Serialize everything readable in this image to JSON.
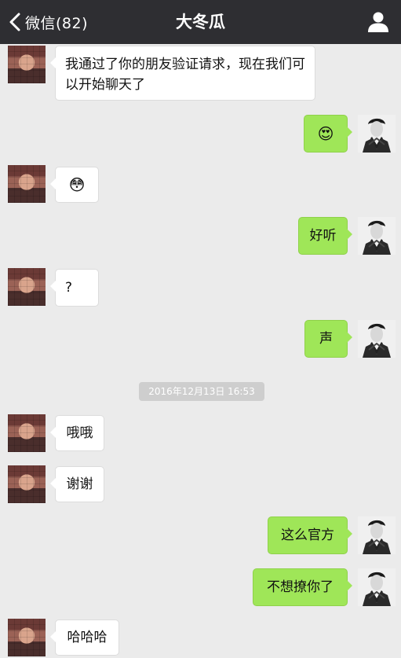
{
  "header": {
    "back_label": "微信(82)",
    "title": "大冬瓜"
  },
  "messages": [
    {
      "side": "left",
      "text": "我通过了你的朋友验证请求，现在我们可以开始聊天了"
    },
    {
      "side": "right",
      "text": "😍"
    },
    {
      "side": "left",
      "text": "😳"
    },
    {
      "side": "right",
      "text": "好听"
    },
    {
      "side": "left",
      "text": "?"
    },
    {
      "side": "right",
      "text": "声"
    },
    {
      "side": "time",
      "text": "2016年12月13日 16:53"
    },
    {
      "side": "left",
      "text": "哦哦"
    },
    {
      "side": "left",
      "text": "谢谢"
    },
    {
      "side": "right",
      "text": "这么官方"
    },
    {
      "side": "right",
      "text": "不想撩你了"
    },
    {
      "side": "left",
      "text": "哈哈哈"
    }
  ],
  "colors": {
    "topbar": "#2e2e32",
    "background": "#ebebeb",
    "outgoing_bubble": "#9fe658",
    "incoming_bubble": "#ffffff"
  },
  "icons": {
    "back": "chevron-left-icon",
    "profile": "person-icon"
  }
}
